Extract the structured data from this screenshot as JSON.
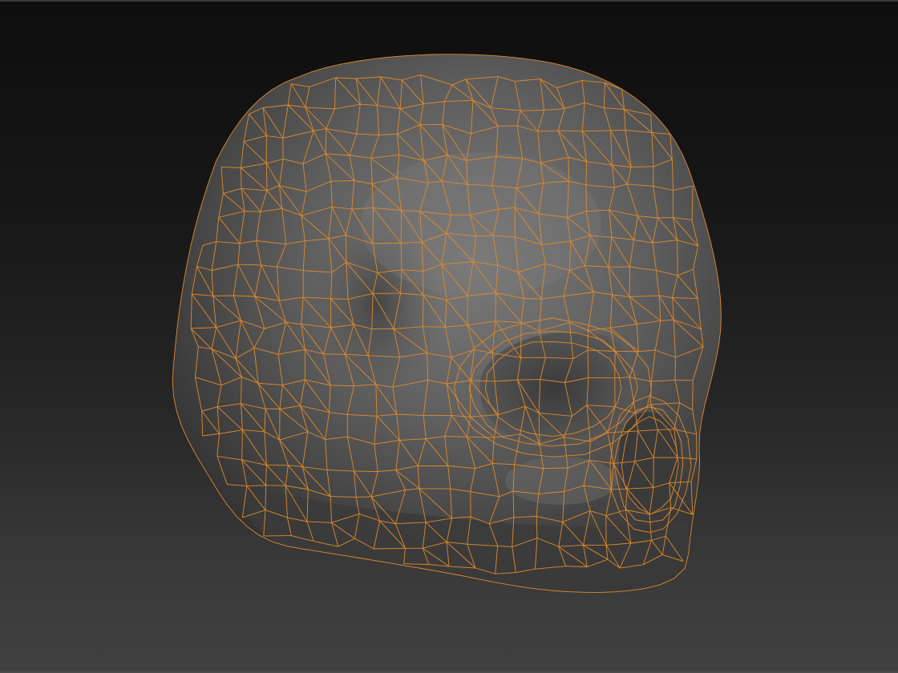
{
  "viewport": {
    "background_top": "#0e0e0e",
    "background_bottom": "#404040"
  },
  "model": {
    "shading_color": "#5e5e5e",
    "shadow_color": "#2c2c2c",
    "highlight_color": "#7a7a7a"
  },
  "wireframe": {
    "color": "#e08a2a",
    "display": "polyframe"
  }
}
